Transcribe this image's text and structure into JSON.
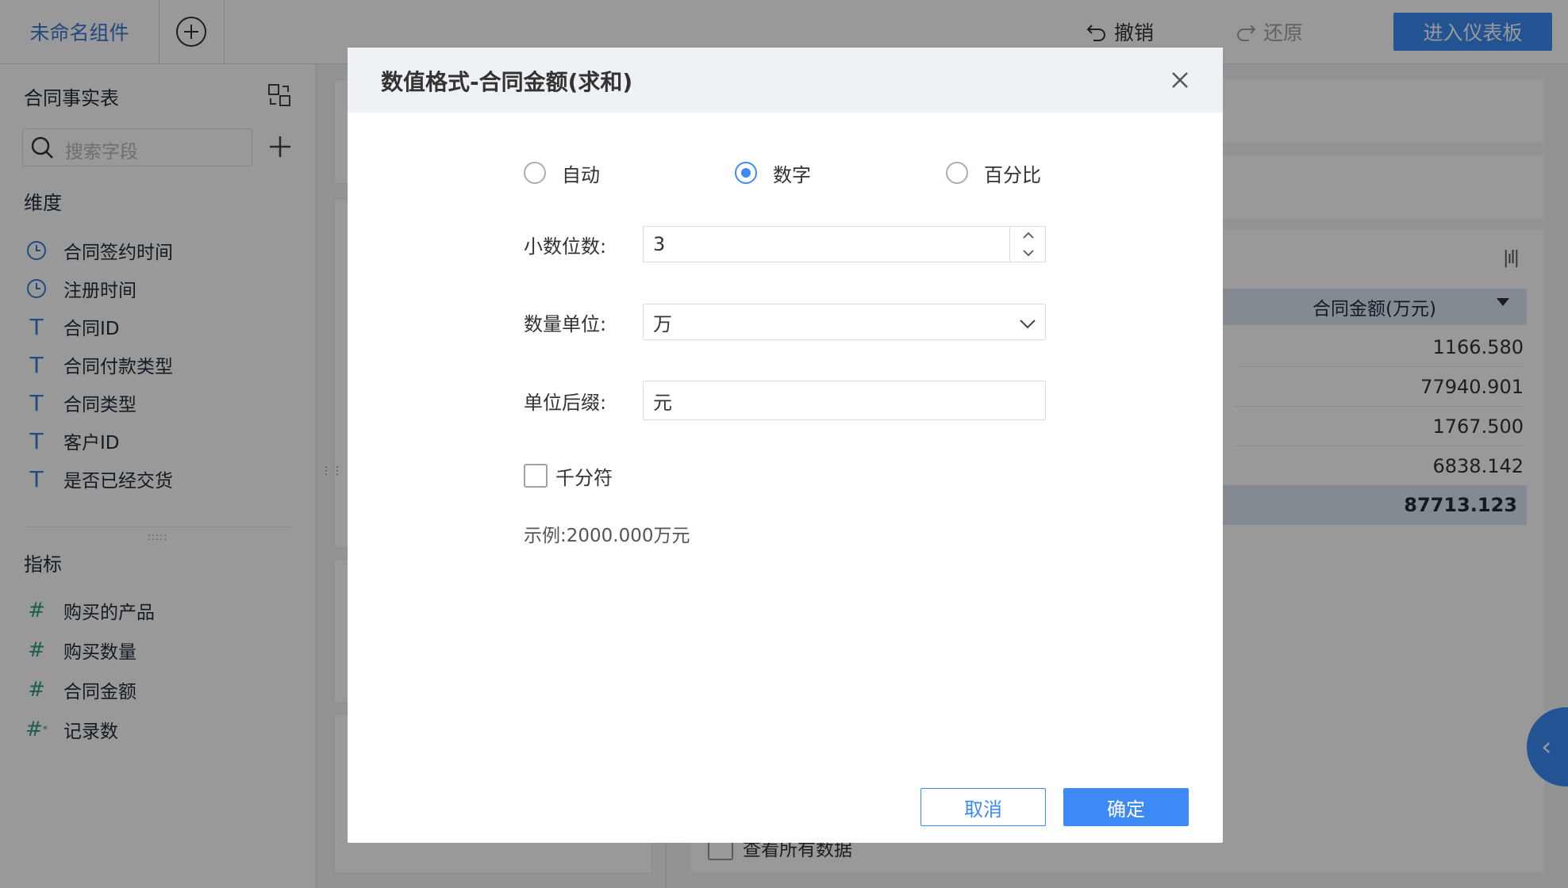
{
  "topbar": {
    "tab_title": "未命名组件",
    "undo_label": "撤销",
    "redo_label": "还原",
    "enter_dashboard_label": "进入仪表板"
  },
  "sidebar": {
    "table_name": "合同事实表",
    "search_placeholder": "搜索字段",
    "dimensions_title": "维度",
    "dimensions": [
      {
        "label": "合同签约时间",
        "icon": "clock-icon"
      },
      {
        "label": "注册时间",
        "icon": "clock-icon"
      },
      {
        "label": "合同ID",
        "icon": "text-type-icon"
      },
      {
        "label": "合同付款类型",
        "icon": "text-type-icon"
      },
      {
        "label": "合同类型",
        "icon": "text-type-icon"
      },
      {
        "label": "客户ID",
        "icon": "text-type-icon"
      },
      {
        "label": "是否已经交货",
        "icon": "text-type-icon"
      }
    ],
    "metrics_title": "指标",
    "metrics": [
      {
        "label": "购买的产品",
        "icon": "number-type-icon"
      },
      {
        "label": "购买数量",
        "icon": "number-type-icon"
      },
      {
        "label": "合同金额",
        "icon": "number-type-icon"
      },
      {
        "label": "记录数",
        "icon": "record-count-icon"
      }
    ]
  },
  "table": {
    "column_header": "合同金额(万元)",
    "rows": [
      "1166.580",
      "77940.901",
      "1767.500",
      "6838.142"
    ],
    "total": "87713.123",
    "view_all_label": "查看所有数据"
  },
  "modal": {
    "title": "数值格式-合同金额(求和)",
    "format_options": [
      {
        "label": "自动",
        "selected": false
      },
      {
        "label": "数字",
        "selected": true
      },
      {
        "label": "百分比",
        "selected": false
      }
    ],
    "decimal_label": "小数位数:",
    "decimal_value": "3",
    "unit_label": "数量单位:",
    "unit_value": "万",
    "suffix_label": "单位后缀:",
    "suffix_value": "元",
    "thousands_label": "千分符",
    "thousands_checked": false,
    "example_text": "示例:2000.000万元",
    "cancel_label": "取消",
    "ok_label": "确定"
  },
  "colors": {
    "accent": "#3d8af7",
    "metric_icon": "#2f9c8c",
    "dimension_icon": "#3b7bd6"
  }
}
